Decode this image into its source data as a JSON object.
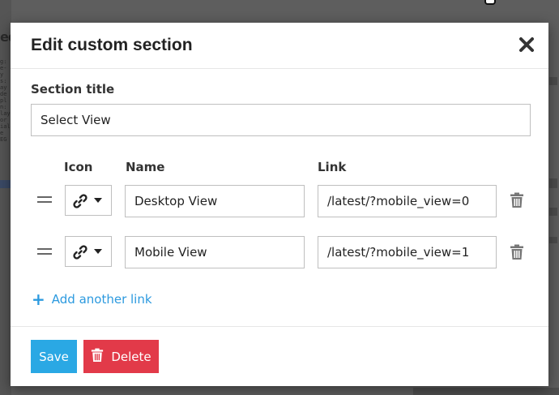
{
  "background": {
    "side_text": "ed"
  },
  "modal": {
    "title": "Edit custom section",
    "close_icon": "close-icon",
    "section_title": {
      "label": "Section title",
      "value": "Select View"
    },
    "columns": {
      "icon": "Icon",
      "name": "Name",
      "link": "Link"
    },
    "links": [
      {
        "icon": "link-icon",
        "name": "Desktop View",
        "link": "/latest/?mobile_view=0"
      },
      {
        "icon": "link-icon",
        "name": "Mobile View",
        "link": "/latest/?mobile_view=1"
      }
    ],
    "add_link_label": "Add another link",
    "save_label": "Save",
    "delete_label": "Delete"
  },
  "colors": {
    "primary": "#2aa8e4",
    "danger": "#e23a49",
    "link": "#2c9adf",
    "overlay": "#5e5e5e"
  }
}
